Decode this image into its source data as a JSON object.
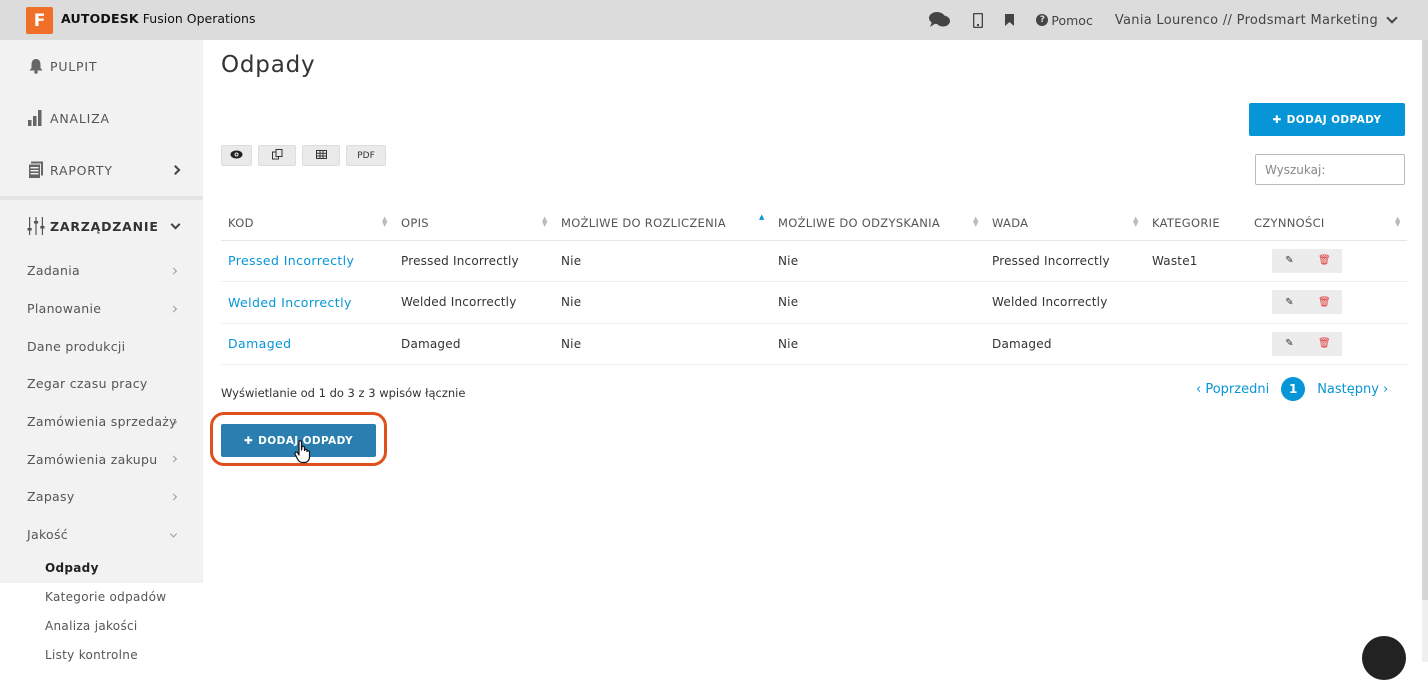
{
  "app": {
    "logo_letter": "F",
    "brand_bold": "AUTODESK",
    "brand_rest": "Fusion Operations",
    "accent": "#0696d7",
    "logo_color": "#f0702a"
  },
  "topbar": {
    "icons": [
      "chat-icon",
      "mobile-icon",
      "bookmark-icon"
    ],
    "help_label": "Pomoc",
    "user_label": "Vania Lourenco // Prodsmart Marketing"
  },
  "sidebar": {
    "main": [
      {
        "label": "PULPIT",
        "icon": "bell-icon"
      },
      {
        "label": "ANALIZA",
        "icon": "bar-chart-icon"
      },
      {
        "label": "RAPORTY",
        "icon": "report-icon"
      },
      {
        "label": "ZARZĄDZANIE",
        "icon": "sliders-icon"
      }
    ],
    "sub": [
      "Zadania",
      "Planowanie",
      "Dane produkcji",
      "Zegar czasu pracy",
      "Zamówienia sprzedaży",
      "Zamówienia zakupu",
      "Zapasy",
      "Jakość"
    ],
    "leaves": [
      "Odpady",
      "Kategorie odpadów",
      "Analiza jakości",
      "Listy kontrolne"
    ]
  },
  "main": {
    "title": "Odpady",
    "add_button": "DODAJ ODPADY",
    "tools": {
      "view": "eye-icon",
      "copy": "copy-icon",
      "table": "table-icon",
      "pdf": "PDF"
    },
    "search_placeholder": "Wyszukaj:",
    "columns": [
      "KOD",
      "OPIS",
      "MOŻLIWE DO ROZLICZENIA",
      "MOŻLIWE DO ODZYSKANIA",
      "WADA",
      "KATEGORIE",
      "CZYNNOŚCI"
    ],
    "rows": [
      {
        "kod": "Pressed Incorrectly",
        "opis": "Pressed Incorrectly",
        "rozliczenia": "Nie",
        "odzyskania": "Nie",
        "wada": "Pressed Incorrectly",
        "kategorie": "Waste1"
      },
      {
        "kod": "Welded Incorrectly",
        "opis": "Welded Incorrectly",
        "rozliczenia": "Nie",
        "odzyskania": "Nie",
        "wada": "Welded Incorrectly",
        "kategorie": ""
      },
      {
        "kod": "Damaged",
        "opis": "Damaged",
        "rozliczenia": "Nie",
        "odzyskania": "Nie",
        "wada": "Damaged",
        "kategorie": ""
      }
    ],
    "info": "Wyświetlanie od 1 do 3 z 3 wpisów łącznie",
    "pager": {
      "prev": "Poprzedni",
      "current": "1",
      "next": "Następny"
    }
  }
}
